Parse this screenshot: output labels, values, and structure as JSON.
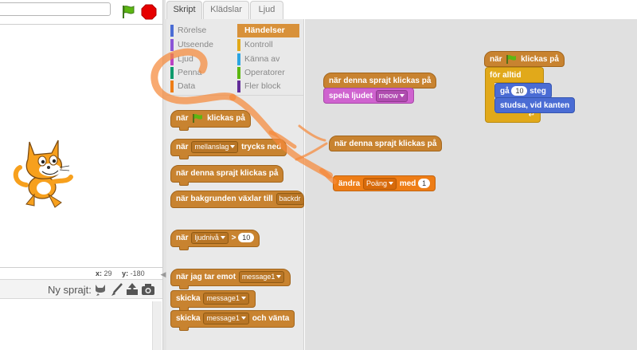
{
  "stage": {
    "coord_x_label": "x:",
    "coord_x_value": "29",
    "coord_y_label": "y:",
    "coord_y_value": "-180",
    "new_sprite_label": "Ny sprajt:"
  },
  "tabs": [
    {
      "label": "Skript",
      "active": true
    },
    {
      "label": "Klädslar",
      "active": false
    },
    {
      "label": "Ljud",
      "active": false
    }
  ],
  "categories": {
    "left": [
      {
        "label": "Rörelse",
        "color": "#4a6cd4"
      },
      {
        "label": "Utseende",
        "color": "#8a55d7"
      },
      {
        "label": "Ljud",
        "color": "#bb42c3"
      },
      {
        "label": "Penna",
        "color": "#0e9a6c"
      },
      {
        "label": "Data",
        "color": "#ee7d16"
      }
    ],
    "right": [
      {
        "label": "Händelser",
        "color": "#c88330",
        "selected": true
      },
      {
        "label": "Kontroll",
        "color": "#e1a91a"
      },
      {
        "label": "Känna av",
        "color": "#2ca5e2"
      },
      {
        "label": "Operatorer",
        "color": "#5cb712"
      },
      {
        "label": "Fler block",
        "color": "#632d99"
      }
    ]
  },
  "palette": {
    "when_flag": {
      "before": "när",
      "after": "klickas på"
    },
    "when_key": {
      "before": "när",
      "key": "mellanslag",
      "after": "trycks ned"
    },
    "when_sprite_clicked": "när denna sprajt klickas på",
    "when_backdrop": {
      "before": "när bakgrunden växlar till",
      "value": "backdr"
    },
    "when_sensor": {
      "before": "när",
      "sensor": "ljudnivå",
      "op": ">",
      "value": "10"
    },
    "when_receive": {
      "before": "när jag tar emot",
      "message": "message1"
    },
    "broadcast": {
      "before": "skicka",
      "message": "message1"
    },
    "broadcast_wait": {
      "before": "skicka",
      "message": "message1",
      "after": "och vänta"
    }
  },
  "scripts": {
    "script1_hat": "när denna sprajt klickas på",
    "script1_sound": {
      "before": "spela ljudet",
      "value": "meow"
    },
    "script2_hat": "när denna sprajt klickas på",
    "script3_change": {
      "before": "ändra",
      "var": "Poäng",
      "mid": "med",
      "value": "1"
    },
    "script4_hat": {
      "before": "när",
      "after": "klickas på"
    },
    "script4_forever": "för alltid",
    "script4_move": {
      "before": "gå",
      "value": "10",
      "after": "steg"
    },
    "script4_bounce": "studsa, vid kanten"
  }
}
